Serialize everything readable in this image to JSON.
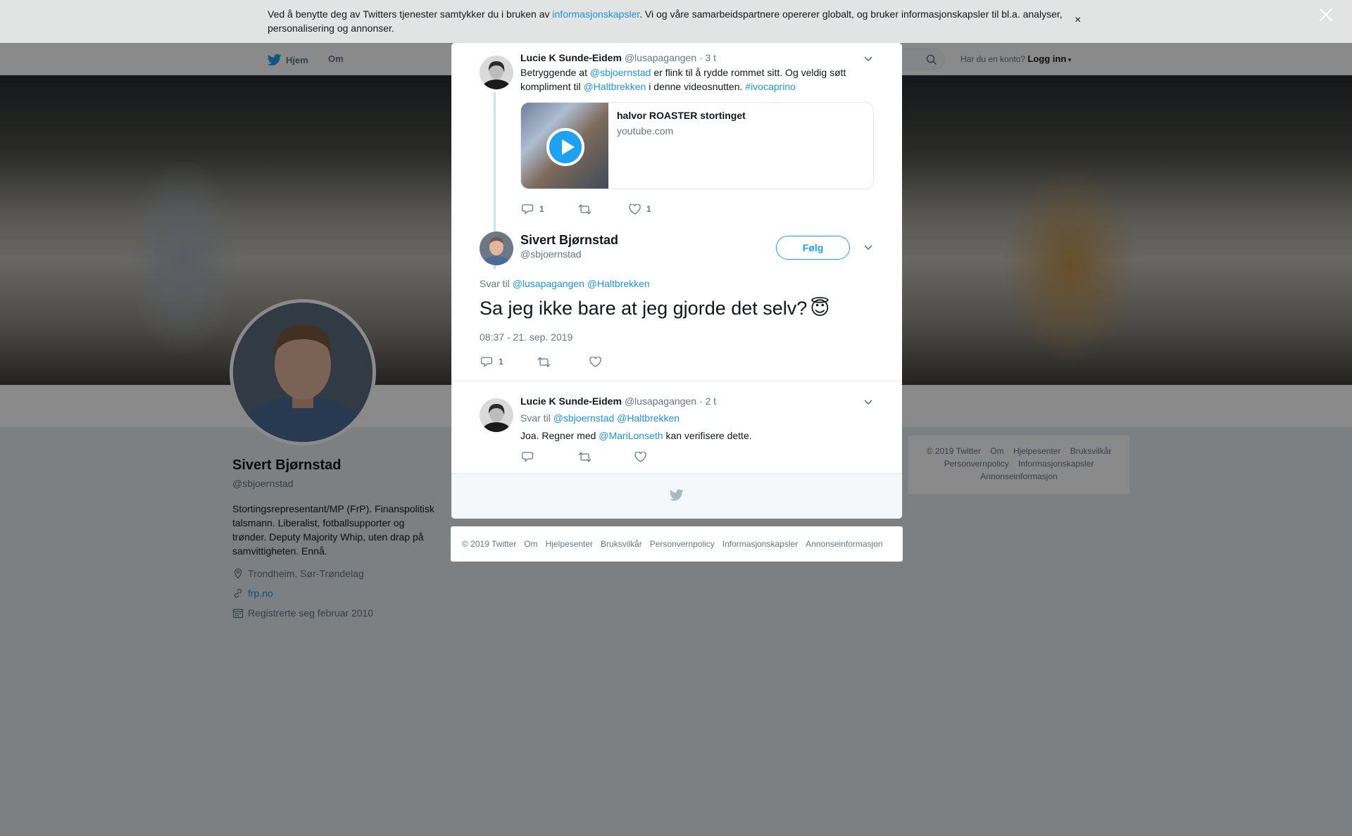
{
  "cookie": {
    "text_before": "Ved å benytte deg av Twitters tjenester samtykker du i bruken av ",
    "link": "informasjonskapsler",
    "text_after": ". Vi og våre samarbeidspartnere opererer globalt, og bruker informasjonskapsler til bl.a. analyser, personalisering og annonser.",
    "close_symbol": "×"
  },
  "nav": {
    "home": "Hjem",
    "about": "Om",
    "login_prompt": "Har du en konto?",
    "login": "Logg inn"
  },
  "profile": {
    "name": "Sivert Bjørnstad",
    "handle": "@sbjoernstad",
    "bio": "Stortingsrepresentant/MP (FrP). Finanspolitisk talsmann. Liberalist, fotballsupporter og trønder. Deputy Majority Whip, uten drap på samvittigheten. Ennå.",
    "location": "Trondheim, Sør-Trøndelag",
    "url": "frp.no",
    "joined": "Registrerte seg februar 2010"
  },
  "modal": {
    "tweet1": {
      "author": "Lucie K Sunde-Eidem",
      "handle": "@lusapagangen",
      "time": "· 3 t",
      "text_a": "Betryggende at ",
      "mention1": "@sbjoernstad",
      "text_b": " er flink til å rydde rommet sitt. Og veldig søtt kompliment til ",
      "mention2": "@Haltbrekken",
      "text_c": " i denne videosnutten. ",
      "hashtag": "#ivocaprino",
      "card_title": "halvor ROASTER stortinget",
      "card_domain": "youtube.com",
      "reply_count": "1",
      "like_count": "1"
    },
    "main": {
      "name": "Sivert Bjørnstad",
      "handle": "@sbjoernstad",
      "follow": "Følg",
      "reply_to_label": "Svar til",
      "reply_to_1": "@lusapagangen",
      "reply_to_2": "@Haltbrekken",
      "text": "Sa jeg ikke bare at jeg gjorde det selv?",
      "emoji": "😇",
      "timestamp": "08:37 - 21. sep. 2019",
      "reply_count": "1"
    },
    "tweet3": {
      "author": "Lucie K Sunde-Eidem",
      "handle": "@lusapagangen",
      "time": "· 2 t",
      "reply_to_label": "Svar til",
      "reply_to_1": "@sbjoernstad",
      "reply_to_2": "@Haltbrekken",
      "text_a": "Joa. Regner med ",
      "mention": "@MariLonseth",
      "text_b": " kan verifisere dette."
    }
  },
  "footer": {
    "copyright": "© 2019 Twitter",
    "about": "Om",
    "help": "Hjelpesenter",
    "terms": "Bruksvilkår",
    "privacy": "Personvernpolicy",
    "cookies": "Informasjonskapsler",
    "ads": "Annonseinformasjon"
  },
  "colors": {
    "accent": "#1da1f2",
    "link": "#1b95e0",
    "thread_line": "#c4e3f7"
  }
}
